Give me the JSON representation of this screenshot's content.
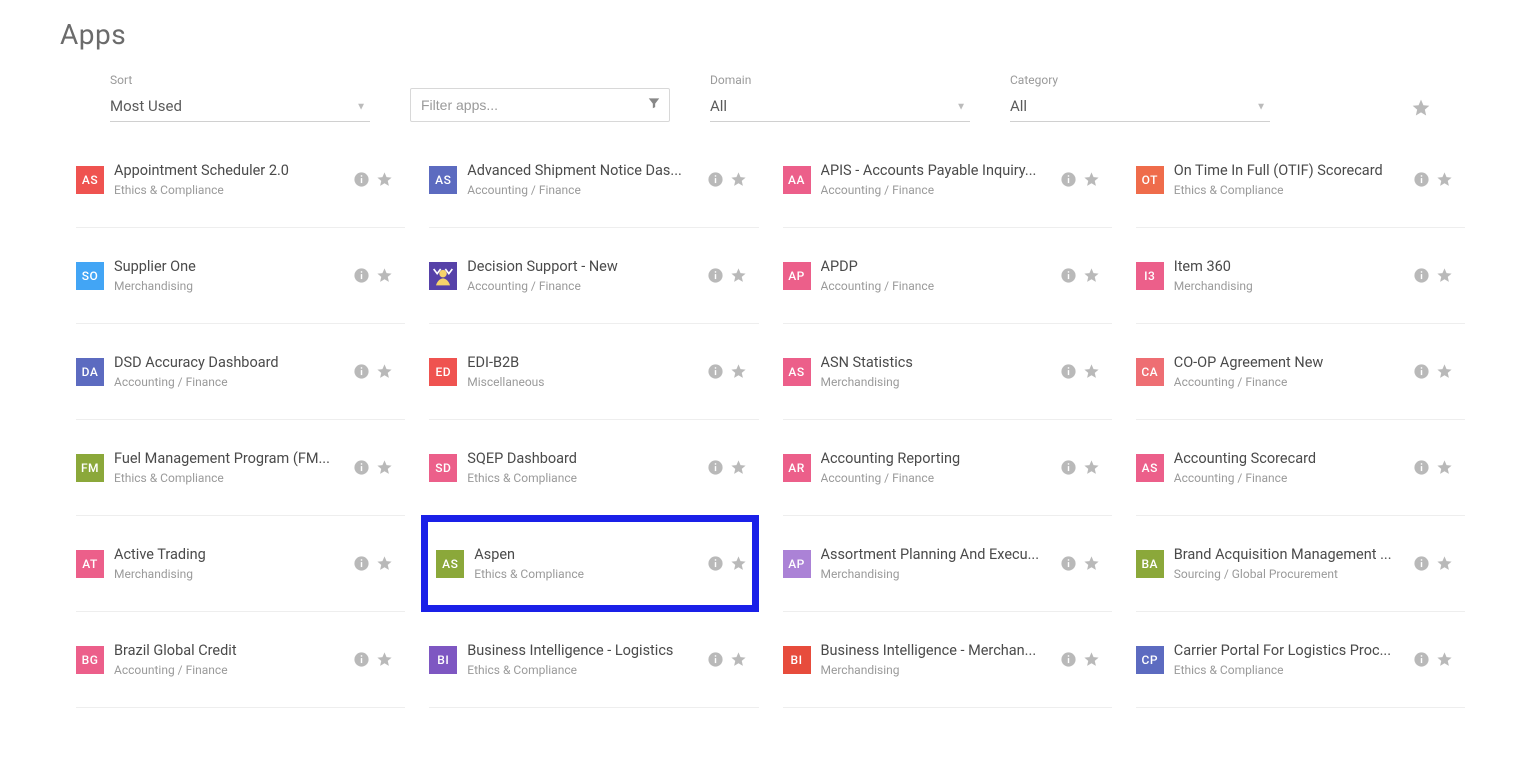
{
  "page": {
    "title": "Apps"
  },
  "filters": {
    "sort": {
      "label": "Sort",
      "value": "Most Used"
    },
    "search": {
      "placeholder": "Filter apps..."
    },
    "domain": {
      "label": "Domain",
      "value": "All"
    },
    "category": {
      "label": "Category",
      "value": "All"
    }
  },
  "apps": [
    {
      "abbrev": "AS",
      "color": "c-salmon",
      "name": "Appointment Scheduler 2.0",
      "category": "Ethics & Compliance"
    },
    {
      "abbrev": "AS",
      "color": "c-indigo",
      "name": "Advanced Shipment Notice Das...",
      "category": "Accounting / Finance"
    },
    {
      "abbrev": "AA",
      "color": "c-pink",
      "name": "APIS - Accounts Payable Inquiry...",
      "category": "Accounting / Finance"
    },
    {
      "abbrev": "OT",
      "color": "c-orange",
      "name": "On Time In Full (OTIF) Scorecard",
      "category": "Ethics & Compliance"
    },
    {
      "abbrev": "SO",
      "color": "c-skyblue",
      "name": "Supplier One",
      "category": "Merchandising"
    },
    {
      "abbrev": "",
      "color": "deco",
      "name": "Decision Support - New",
      "category": "Accounting / Finance",
      "deco": true
    },
    {
      "abbrev": "AP",
      "color": "c-pink",
      "name": "APDP",
      "category": "Accounting / Finance"
    },
    {
      "abbrev": "I3",
      "color": "c-pink",
      "name": "Item 360",
      "category": "Merchandising"
    },
    {
      "abbrev": "DA",
      "color": "c-indigo",
      "name": "DSD Accuracy Dashboard",
      "category": "Accounting / Finance"
    },
    {
      "abbrev": "ED",
      "color": "c-salmon",
      "name": "EDI-B2B",
      "category": "Miscellaneous"
    },
    {
      "abbrev": "AS",
      "color": "c-pink",
      "name": "ASN Statistics",
      "category": "Merchandising"
    },
    {
      "abbrev": "CA",
      "color": "c-coral",
      "name": "CO-OP Agreement New",
      "category": "Accounting / Finance"
    },
    {
      "abbrev": "FM",
      "color": "c-army",
      "name": "Fuel Management Program (FM...",
      "category": "Ethics & Compliance"
    },
    {
      "abbrev": "SD",
      "color": "c-pink",
      "name": "SQEP Dashboard",
      "category": "Ethics & Compliance"
    },
    {
      "abbrev": "AR",
      "color": "c-pink",
      "name": "Accounting Reporting",
      "category": "Accounting / Finance"
    },
    {
      "abbrev": "AS",
      "color": "c-pink",
      "name": "Accounting Scorecard",
      "category": "Accounting / Finance"
    },
    {
      "abbrev": "AT",
      "color": "c-pink",
      "name": "Active Trading",
      "category": "Merchandising"
    },
    {
      "abbrev": "AS",
      "color": "c-army",
      "name": "Aspen",
      "category": "Ethics & Compliance",
      "highlight": true
    },
    {
      "abbrev": "AP",
      "color": "c-lav",
      "name": "Assortment Planning And Execu...",
      "category": "Merchandising"
    },
    {
      "abbrev": "BA",
      "color": "c-army",
      "name": "Brand Acquisition Management ...",
      "category": "Sourcing / Global Procurement"
    },
    {
      "abbrev": "BG",
      "color": "c-pink",
      "name": "Brazil Global Credit",
      "category": "Accounting / Finance"
    },
    {
      "abbrev": "BI",
      "color": "c-purple",
      "name": "Business Intelligence - Logistics",
      "category": "Ethics & Compliance"
    },
    {
      "abbrev": "BI",
      "color": "c-red",
      "name": "Business Intelligence - Merchan...",
      "category": "Merchandising"
    },
    {
      "abbrev": "CP",
      "color": "c-indigo",
      "name": "Carrier Portal For Logistics Proc...",
      "category": "Ethics & Compliance"
    }
  ]
}
